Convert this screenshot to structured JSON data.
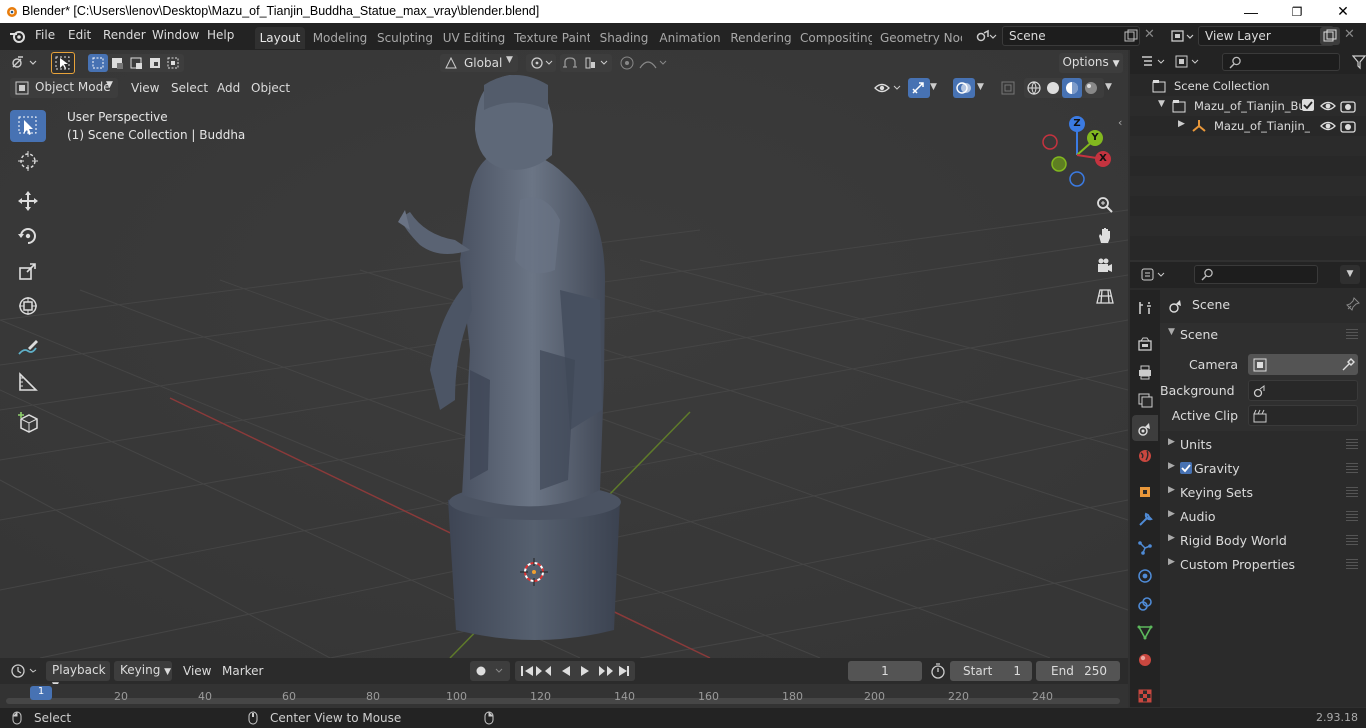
{
  "window": {
    "title": "Blender* [C:\\Users\\lenov\\Desktop\\Mazu_of_Tianjin_Buddha_Statue_max_vray\\blender.blend]",
    "minimize": "—",
    "maximize": "❐",
    "close": "✕"
  },
  "menubar": {
    "items": [
      "File",
      "Edit",
      "Render",
      "Window",
      "Help"
    ],
    "workspaces": [
      "Layout",
      "Modeling",
      "Sculpting",
      "UV Editing",
      "Texture Paint",
      "Shading",
      "Animation",
      "Rendering",
      "Compositing",
      "Geometry Nod"
    ],
    "active_workspace": "Layout",
    "scene": "Scene",
    "view_layer": "View Layer"
  },
  "viewport_header": {
    "transform_orientation": "Global",
    "options": "Options",
    "mode": "Object Mode",
    "menus": [
      "View",
      "Select",
      "Add",
      "Object"
    ]
  },
  "viewport": {
    "perspective": "User Perspective",
    "collection_info": "(1) Scene Collection | Buddha",
    "gizmo": {
      "x": "X",
      "y": "Y",
      "z": "Z"
    }
  },
  "toolbar": {
    "tools": [
      "select-box",
      "cursor",
      "move",
      "rotate",
      "scale",
      "transform",
      "annotate",
      "measure",
      "add-cube"
    ],
    "active_tool": "select-box"
  },
  "outliner": {
    "root": "Scene Collection",
    "items": [
      {
        "label": "Mazu_of_Tianjin_Bud"
      },
      {
        "label": "Mazu_of_Tianjin_"
      }
    ]
  },
  "properties": {
    "context_title": "Scene",
    "panel_title": "Scene",
    "fields": [
      {
        "label": "Camera",
        "value": ""
      },
      {
        "label": "Background ...",
        "value": ""
      },
      {
        "label": "Active Clip",
        "value": ""
      }
    ],
    "sections": [
      {
        "label": "Units"
      },
      {
        "label": "Gravity",
        "checked": true
      },
      {
        "label": "Keying Sets"
      },
      {
        "label": "Audio"
      },
      {
        "label": "Rigid Body World"
      },
      {
        "label": "Custom Properties"
      }
    ]
  },
  "timeline": {
    "menus": [
      "Playback",
      "Keying",
      "View",
      "Marker"
    ],
    "current_frame": "1",
    "start_label": "Start",
    "start": "1",
    "end_label": "End",
    "end": "250",
    "ticks": [
      "1",
      "20",
      "40",
      "60",
      "80",
      "100",
      "120",
      "140",
      "160",
      "180",
      "200",
      "220",
      "240"
    ]
  },
  "statusbar": {
    "select": "Select",
    "center_view": "Center View to Mouse",
    "version": "2.93.18"
  },
  "colors": {
    "accent": "#4772b3",
    "x_axis": "#c5333f",
    "y_axis": "#82b81f",
    "z_axis": "#3b7be3"
  }
}
